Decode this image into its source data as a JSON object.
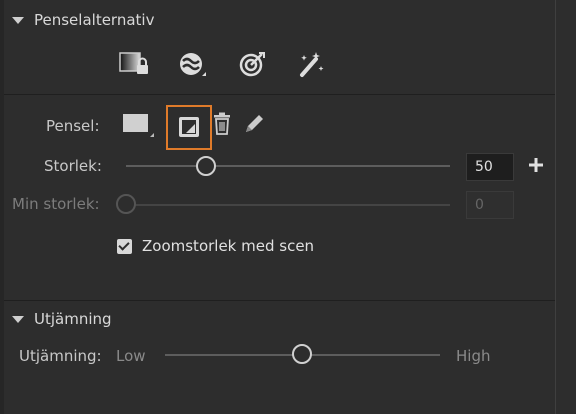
{
  "sections": {
    "brush_options": {
      "title": "Penselalternativ"
    },
    "smoothing": {
      "title": "Utjämning"
    }
  },
  "toolbar_icons": [
    "lock-transparency-icon",
    "pressure-size-icon",
    "pressure-opacity-icon",
    "magic-brush-icon"
  ],
  "brush": {
    "label": "Pensel:",
    "icons": [
      "brush-preset-swatch-icon",
      "brush-tip-icon",
      "delete-icon",
      "edit-brush-icon"
    ]
  },
  "size": {
    "label": "Storlek:",
    "value": "50",
    "fraction": 0.23
  },
  "min_size": {
    "label": "Min storlek:",
    "value": "0",
    "fraction": 0.0
  },
  "zoom_checkbox": {
    "label": "Zoomstorlek med scen",
    "checked": true
  },
  "smoothing_slider": {
    "label": "Utjämning:",
    "low": "Low",
    "high": "High",
    "fraction": 0.5
  },
  "colors": {
    "highlight": "#e07b2a",
    "background": "#2d2d2d"
  }
}
